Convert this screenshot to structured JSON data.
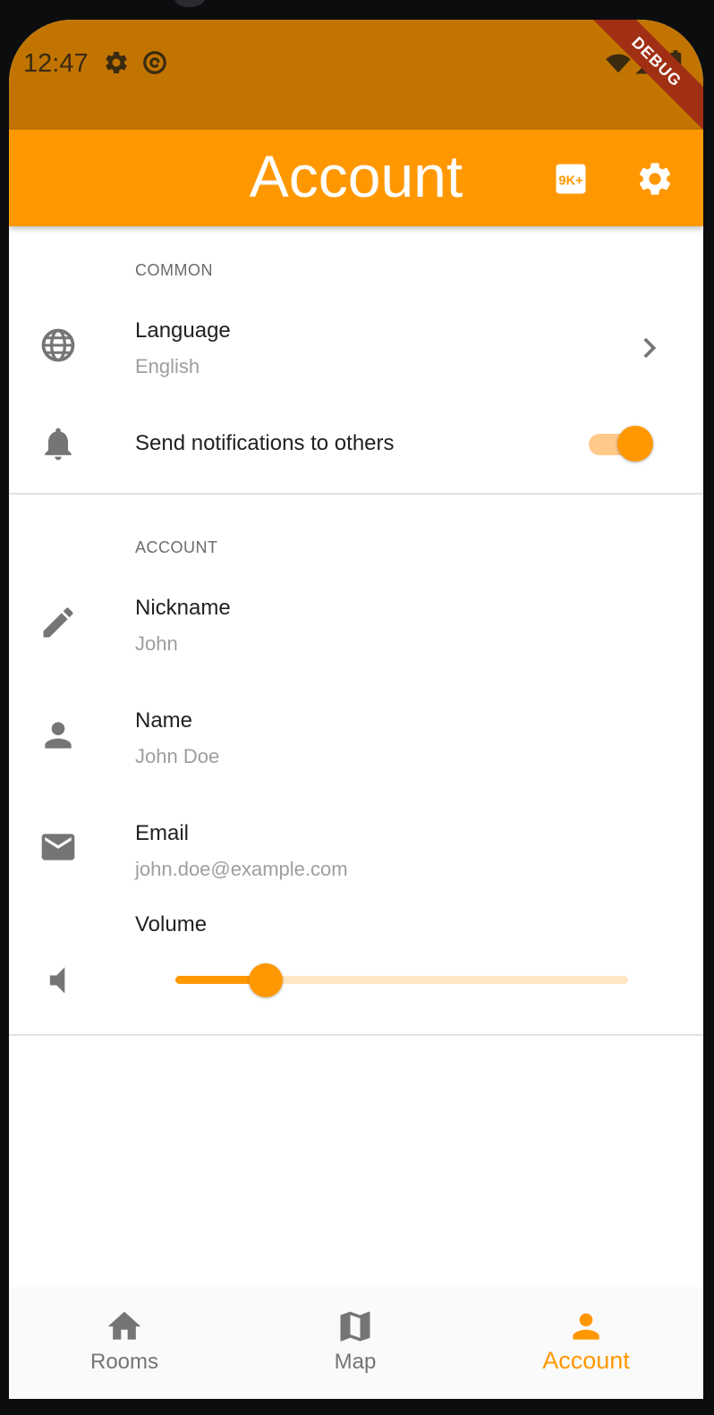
{
  "status_bar": {
    "time": "12:47",
    "icons": [
      "gear-icon",
      "at-sign-icon",
      "wifi-icon",
      "signal-icon",
      "battery-icon"
    ]
  },
  "debug_banner": "DEBUG",
  "app_bar": {
    "title": "Account",
    "actions": [
      "9k-plus-icon",
      "gear-icon"
    ]
  },
  "sections": {
    "common": {
      "header": "COMMON",
      "language": {
        "title": "Language",
        "subtitle": "English",
        "icon": "globe-icon"
      },
      "notifications": {
        "title": "Send notifications to others",
        "icon": "bell-icon",
        "enabled": true
      }
    },
    "account": {
      "header": "ACCOUNT",
      "nickname": {
        "title": "Nickname",
        "subtitle": "John",
        "icon": "pencil-icon"
      },
      "name": {
        "title": "Name",
        "subtitle": "John Doe",
        "icon": "person-icon"
      },
      "email": {
        "title": "Email",
        "subtitle": "john.doe@example.com",
        "icon": "mail-icon"
      },
      "volume": {
        "title": "Volume",
        "icon": "volume-icon",
        "value": 0.2
      }
    }
  },
  "bottom_nav": {
    "items": [
      {
        "label": "Rooms",
        "icon": "home-icon"
      },
      {
        "label": "Map",
        "icon": "map-icon"
      },
      {
        "label": "Account",
        "icon": "person-icon"
      }
    ],
    "active": 2
  },
  "colors": {
    "primary": "#ff9800",
    "status_bar": "#c17400",
    "debug_ribbon": "#a12f14",
    "icon_grey": "#757575"
  }
}
